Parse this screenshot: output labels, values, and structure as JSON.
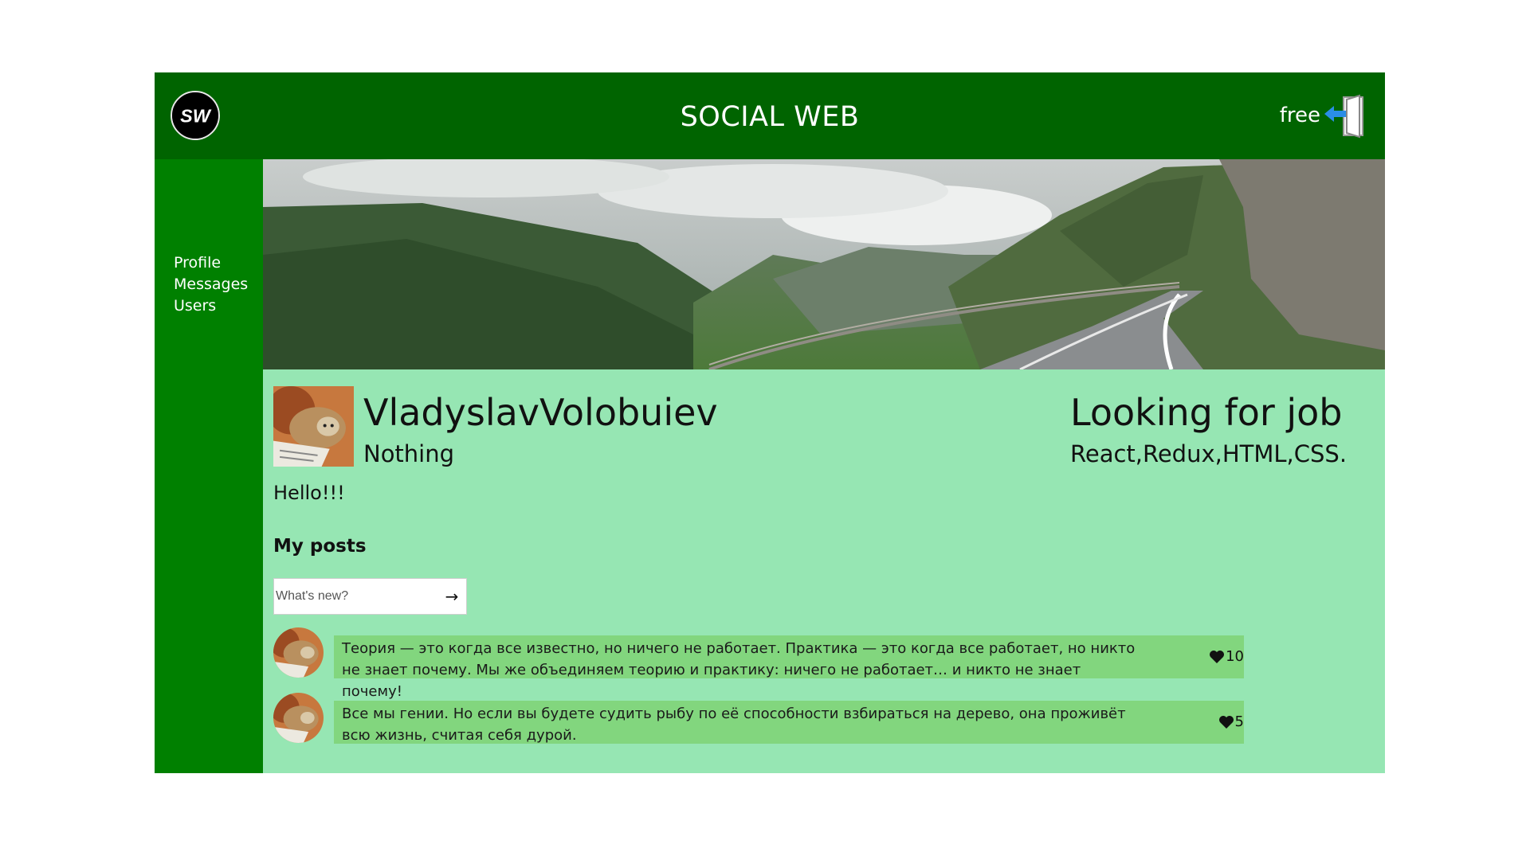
{
  "header": {
    "title": "SOCIAL WEB",
    "logo_text": "SW",
    "login_name": "free",
    "logout_icon": "door-exit-icon"
  },
  "sidebar": {
    "items": [
      {
        "label": "Profile"
      },
      {
        "label": "Messages"
      },
      {
        "label": "Users"
      }
    ]
  },
  "profile": {
    "full_name": "VladyslavVolobuiev",
    "status": "Nothing",
    "job_title": "Looking for job",
    "job_description": "React,Redux,HTML,CSS.",
    "about_me": "Hello!!!"
  },
  "posts_section": {
    "title": "My posts",
    "input_placeholder": "What's new?",
    "send_label": "→",
    "posts": [
      {
        "text": "Теория — это когда все известно, но ничего не работает. Практика — это когда все работает, но никто не знает почему. Мы же объединяем теорию и практику: ничего не работает… и никто не знает почему!",
        "likes": "10"
      },
      {
        "text": "Все мы гении. Но если вы будете судить рыбу по её способности взбираться на дерево, она проживёт всю жизнь, считая себя дурой.",
        "likes": "5"
      }
    ]
  },
  "colors": {
    "header": "#006400",
    "sidebar": "#008000",
    "content": "#96e6b3",
    "post_bubble": "#82d67e"
  }
}
